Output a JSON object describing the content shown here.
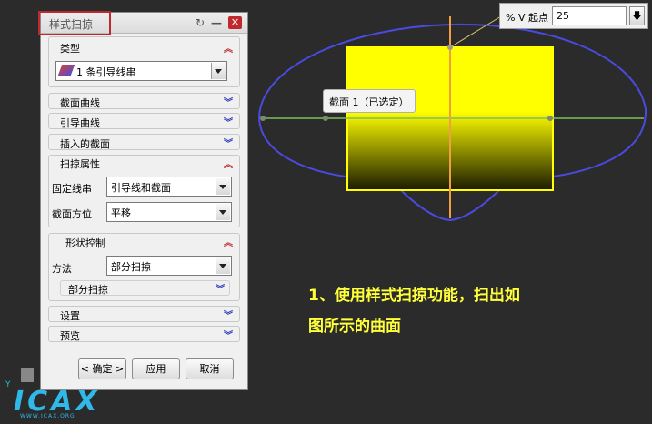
{
  "dialog": {
    "title": "样式扫掠",
    "sections": {
      "type": {
        "label": "类型",
        "value": "1 条引导线串"
      },
      "section_curve": {
        "label": "截面曲线"
      },
      "guide_curve": {
        "label": "引导曲线"
      },
      "inserted_section": {
        "label": "插入的截面"
      },
      "sweep_props": {
        "label": "扫掠属性",
        "fixed_string_label": "固定线串",
        "fixed_string_value": "引导线和截面",
        "orientation_label": "截面方位",
        "orientation_value": "平移"
      },
      "shape_control": {
        "label": "形状控制",
        "method_label": "方法",
        "method_value": "部分扫掠",
        "partial_sweep_label": "部分扫掠"
      },
      "settings": {
        "label": "设置"
      },
      "preview": {
        "label": "预览"
      }
    },
    "buttons": {
      "ok": "< 确定 >",
      "apply": "应用",
      "cancel": "取消"
    }
  },
  "v_start": {
    "label": "% V 起点",
    "value": "25"
  },
  "section_tag": "截面 1（已选定）",
  "annotation": {
    "line1": "1、使用样式扫掠功能，扫出如",
    "line2": "图所示的曲面"
  },
  "logo": {
    "brand": "ICAX",
    "url": "WWW.ICAX.ORG",
    "axis": "Y"
  },
  "colors": {
    "surface_yellow": "#ffff00",
    "curve_blue": "#4a4ae0",
    "guide_green": "#7dbf5a",
    "section_orange": "#f0a040",
    "annotation_yellow": "#ffff3a",
    "highlight_red": "#c0282d"
  }
}
